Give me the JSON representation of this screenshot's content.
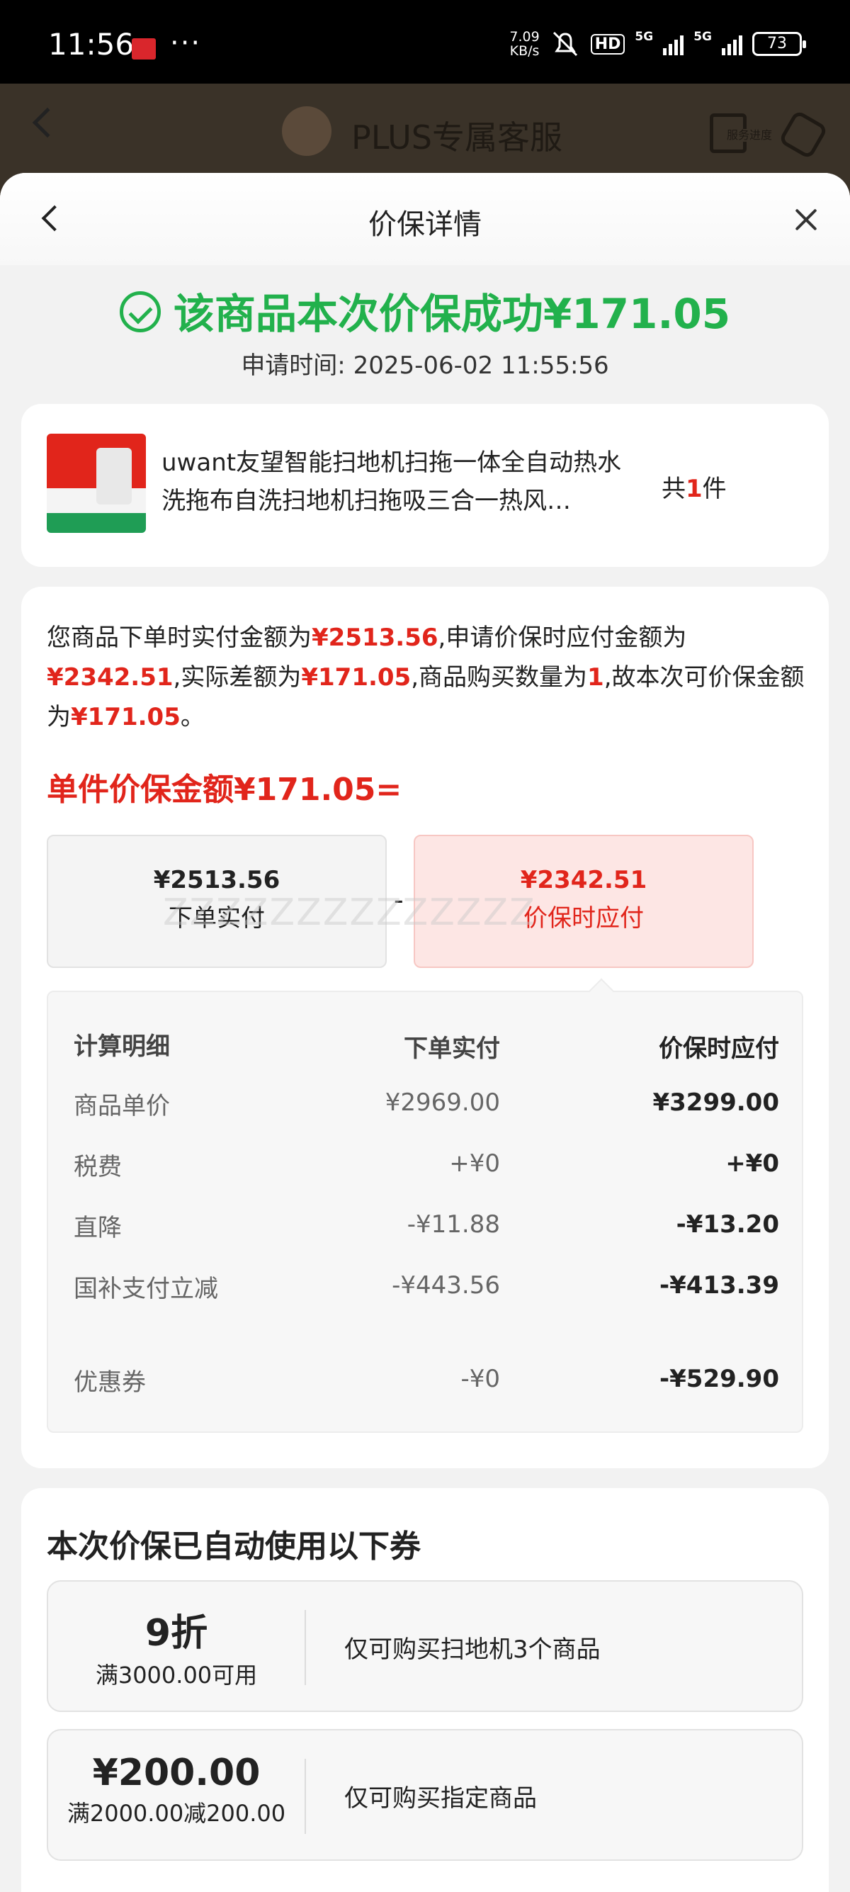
{
  "status_bar": {
    "time": "11:56",
    "dots": "···",
    "speed_value": "7.09",
    "speed_unit": "KB/s",
    "hd_label": "HD",
    "net1": "5G",
    "net2": "5G",
    "battery": "73"
  },
  "bg_header": {
    "title": "PLUS专属客服",
    "service_progress": "服务进度"
  },
  "sheet": {
    "title": "价保详情"
  },
  "result": {
    "success_text": "该商品本次价保成功¥171.05",
    "apply_time": "申请时间: 2025-06-02 11:55:56"
  },
  "product": {
    "name": "uwant友望智能扫地机扫拖一体全自动热水洗拖布自洗扫地机扫拖吸三合一热风…",
    "qty_prefix": "共",
    "qty": "1",
    "qty_suffix": "件"
  },
  "calc": {
    "desc_1": "您商品下单时实付金额为",
    "paid_amount": "¥2513.56",
    "desc_2": ",申请价保时应付金额为",
    "should_amount": "¥2342.51",
    "desc_3": ",实际差额为",
    "diff_amount": "¥171.05",
    "desc_4": ",商品购买数量为",
    "qty": "1",
    "desc_5": ",故本次可价保金额为",
    "refund_amount": "¥171.05",
    "desc_6": "。",
    "unit_amount_text": "单件价保金额¥171.05=",
    "box_paid_amount": "¥2513.56",
    "box_paid_label": "下单实付",
    "box_should_amount": "¥2342.51",
    "box_should_label": "价保时应付",
    "minus": "-",
    "decoration": "ZZZZZZZZZZZZZZ"
  },
  "detail": {
    "headers": [
      "计算明细",
      "下单实付",
      "价保时应付"
    ],
    "rows": [
      {
        "label": "商品单价",
        "paid": "¥2969.00",
        "should": "¥3299.00"
      },
      {
        "label": "税费",
        "paid": "+¥0",
        "should": "+¥0"
      },
      {
        "label": "直降",
        "paid": "-¥11.88",
        "should": "-¥13.20"
      },
      {
        "label": "国补支付立减",
        "paid": "-¥443.56",
        "should": "-¥413.39"
      },
      {
        "label": "优惠券",
        "paid": "-¥0",
        "should": "-¥529.90"
      }
    ]
  },
  "coupons": {
    "title": "本次价保已自动使用以下券",
    "items": [
      {
        "face": "9折",
        "condition": "满3000.00可用",
        "scope": "仅可购买扫地机3个商品"
      },
      {
        "face": "¥200.00",
        "condition": "满2000.00减200.00",
        "scope": "仅可购买指定商品"
      }
    ]
  },
  "colors": {
    "success": "#22b14c",
    "accent_red": "#e1251b"
  }
}
